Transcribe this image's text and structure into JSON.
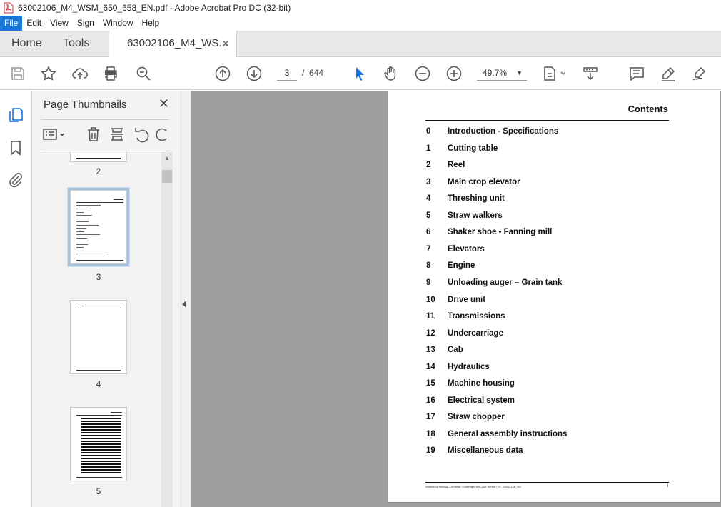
{
  "window": {
    "title": "63002106_M4_WSM_650_658_EN.pdf - Adobe Acrobat Pro DC (32-bit)"
  },
  "menu": {
    "items": [
      "File",
      "Edit",
      "View",
      "Sign",
      "Window",
      "Help"
    ]
  },
  "tabs": {
    "home": "Home",
    "tools": "Tools",
    "document": "63002106_M4_WS...",
    "close": "✕"
  },
  "toolbar": {
    "current_page": "3",
    "page_separator": "/",
    "total_pages": "644",
    "zoom": "49.7%"
  },
  "panel": {
    "title": "Page Thumbnails",
    "close": "✕",
    "thumbnails": [
      {
        "label": "2"
      },
      {
        "label": "3",
        "selected": true
      },
      {
        "label": "4"
      },
      {
        "label": "5"
      }
    ]
  },
  "document": {
    "heading": "Contents",
    "entries": [
      {
        "num": "0",
        "title": "Introduction - Specifications"
      },
      {
        "num": "1",
        "title": "Cutting table"
      },
      {
        "num": "2",
        "title": "Reel"
      },
      {
        "num": "3",
        "title": "Main crop elevator"
      },
      {
        "num": "4",
        "title": "Threshing unit"
      },
      {
        "num": "5",
        "title": "Straw walkers"
      },
      {
        "num": "6",
        "title": "Shaker shoe - Fanning mill"
      },
      {
        "num": "7",
        "title": "Elevators"
      },
      {
        "num": "8",
        "title": "Engine"
      },
      {
        "num": "9",
        "title": "Unloading auger – Grain tank"
      },
      {
        "num": "10",
        "title": "Drive unit"
      },
      {
        "num": "11",
        "title": "Transmissions"
      },
      {
        "num": "12",
        "title": "Undercarriage"
      },
      {
        "num": "13",
        "title": "Cab"
      },
      {
        "num": "14",
        "title": "Hydraulics"
      },
      {
        "num": "15",
        "title": "Machine housing"
      },
      {
        "num": "16",
        "title": "Electrical system"
      },
      {
        "num": "17",
        "title": "Straw chopper"
      },
      {
        "num": "18",
        "title": "General assembly instructions"
      },
      {
        "num": "19",
        "title": "Miscellaneous data"
      }
    ],
    "footer_text": "Workshop Manual Combine Challenger 650-658 Series • 07_63002106_M4",
    "footer_page": "i"
  },
  "colors": {
    "accent": "#1976d2",
    "viewer_bg": "#9d9d9d",
    "icon": "#555555",
    "selected_tool": "#1473e6"
  }
}
